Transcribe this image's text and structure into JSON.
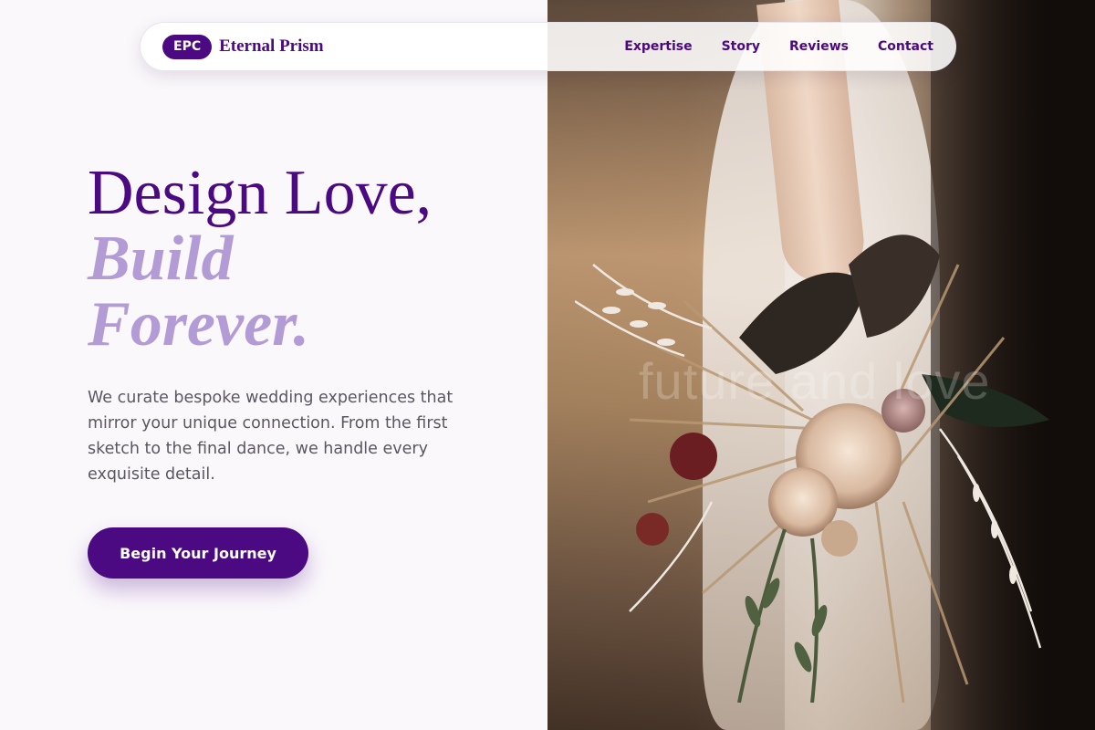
{
  "brand": {
    "badge": "EPC",
    "name": "Eternal Prism"
  },
  "nav": {
    "links": [
      "Expertise",
      "Story",
      "Reviews",
      "Contact"
    ]
  },
  "hero": {
    "title_line1": "Design Love,",
    "title_line2": "Build",
    "title_line3": "Forever.",
    "description": "We curate bespoke wedding experiences that mirror your unique connection. From the first sketch to the final dance, we handle every exquisite detail.",
    "cta_label": "Begin Your Journey"
  },
  "photo": {
    "alt": "Bride holding a dried flower bouquet",
    "watermark": "future and love"
  },
  "colors": {
    "primary": "#4b0a82",
    "accent": "#b39bd6",
    "background": "#fbf8fc",
    "body_text": "#5b5660"
  }
}
